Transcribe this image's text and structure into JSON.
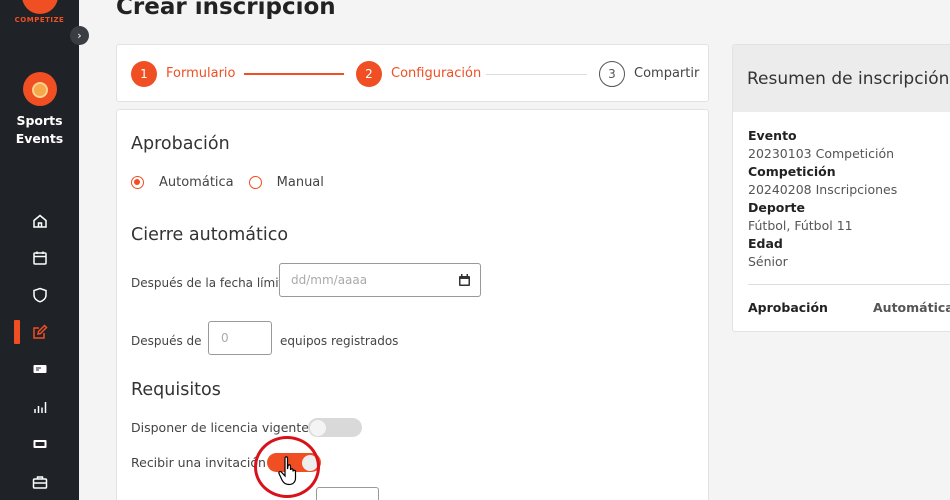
{
  "brand": {
    "name": "COMPETIZE"
  },
  "organization": {
    "name_line1": "Sports",
    "name_line2": "Events"
  },
  "nav": {
    "collapse_icon": "chevron-right-icon",
    "items": [
      {
        "icon": "home-icon"
      },
      {
        "icon": "calendar-icon"
      },
      {
        "icon": "shield-icon"
      },
      {
        "icon": "edit-icon",
        "active": true
      },
      {
        "icon": "ticket-icon"
      },
      {
        "icon": "bar-chart-icon"
      },
      {
        "icon": "card-icon"
      },
      {
        "icon": "briefcase-icon"
      }
    ]
  },
  "page": {
    "title": "Crear inscripción"
  },
  "stepper": {
    "steps": [
      {
        "number": "1",
        "label": "Formulario",
        "state": "done"
      },
      {
        "number": "2",
        "label": "Configuración",
        "state": "current"
      },
      {
        "number": "3",
        "label": "Compartir",
        "state": "pending"
      }
    ]
  },
  "form": {
    "approval": {
      "title": "Aprobación",
      "options": [
        {
          "label": "Automática",
          "selected": true
        },
        {
          "label": "Manual",
          "selected": false
        }
      ]
    },
    "auto_close": {
      "title": "Cierre automático",
      "after_date_label": "Después de la fecha límite",
      "date_placeholder": "dd/mm/aaaa",
      "after_prefix": "Después de",
      "teams_placeholder": "0",
      "after_suffix": "equipos registrados"
    },
    "requirements": {
      "title": "Requisitos",
      "license_label": "Disponer de licencia vigente",
      "license_enabled": false,
      "invitation_label": "Recibir una invitación",
      "invitation_enabled": true
    }
  },
  "summary": {
    "title": "Resumen de inscripción",
    "event_label": "Evento",
    "event_value": "20230103 Competición",
    "competition_label": "Competición",
    "competition_value": "20240208 Inscripciones",
    "sport_label": "Deporte",
    "sport_value": "Fútbol, Fútbol 11",
    "age_label": "Edad",
    "age_value": "Sénior",
    "approval_label": "Aprobación",
    "approval_value": "Automática"
  },
  "colors": {
    "accent": "#f04e23",
    "sidebar": "#1f2227",
    "highlight": "#d8111b"
  }
}
